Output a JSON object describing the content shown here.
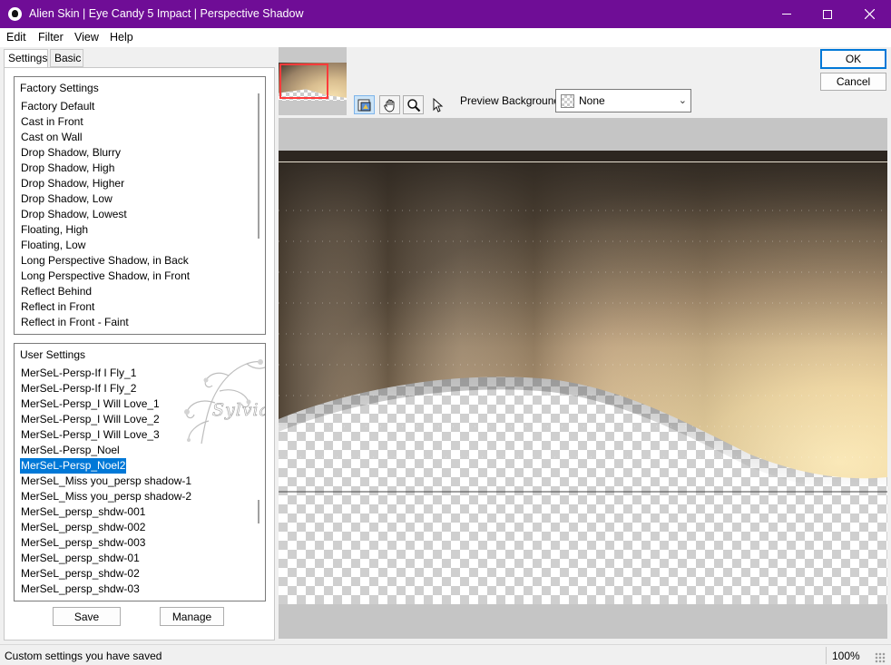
{
  "window": {
    "title": "Alien Skin | Eye Candy 5 Impact | Perspective Shadow",
    "titlebar_color": "#6f0d96"
  },
  "menu": {
    "items": [
      {
        "label": "Edit"
      },
      {
        "label": "Filter"
      },
      {
        "label": "View"
      },
      {
        "label": "Help"
      }
    ]
  },
  "tabs": [
    {
      "label": "Settings",
      "active": true
    },
    {
      "label": "Basic",
      "active": false
    }
  ],
  "factory_settings": {
    "header": "Factory Settings",
    "items": [
      "Factory Default",
      "Cast in Front",
      "Cast on Wall",
      "Drop Shadow, Blurry",
      "Drop Shadow, High",
      "Drop Shadow, Higher",
      "Drop Shadow, Low",
      "Drop Shadow, Lowest",
      "Floating, High",
      "Floating, Low",
      "Long Perspective Shadow, in Back",
      "Long Perspective Shadow, in Front",
      "Reflect Behind",
      "Reflect in Front",
      "Reflect in Front - Faint"
    ]
  },
  "user_settings": {
    "header": "User Settings",
    "selected": "MerSeL-Persp_Noel2",
    "watermark": "Sylviane",
    "items": [
      "MerSeL-Persp-If I Fly_1",
      "MerSeL-Persp-If I Fly_2",
      "MerSeL-Persp_I Will Love_1",
      "MerSeL-Persp_I Will Love_2",
      "MerSeL-Persp_I Will Love_3",
      "MerSeL-Persp_Noel",
      "MerSeL-Persp_Noel2",
      "MerSeL_Miss you_persp shadow-1",
      "MerSeL_Miss you_persp shadow-2",
      "MerSeL_persp_shdw-001",
      "MerSeL_persp_shdw-002",
      "MerSeL_persp_shdw-003",
      "MerSeL_persp_shdw-01",
      "MerSeL_persp_shdw-02",
      "MerSeL_persp_shdw-03"
    ]
  },
  "buttons": {
    "save": "Save",
    "manage": "Manage",
    "ok": "OK",
    "cancel": "Cancel"
  },
  "toolbar": {
    "tools": [
      "preview-toggle-icon",
      "hand-icon",
      "zoom-icon",
      "pointer-icon"
    ]
  },
  "preview_background": {
    "label": "Preview Background:",
    "value": "None"
  },
  "status": {
    "text": "Custom settings you have saved",
    "zoom": "100%"
  },
  "colors": {
    "selection": "#0078d7",
    "default_button_border": "#0078d7"
  }
}
